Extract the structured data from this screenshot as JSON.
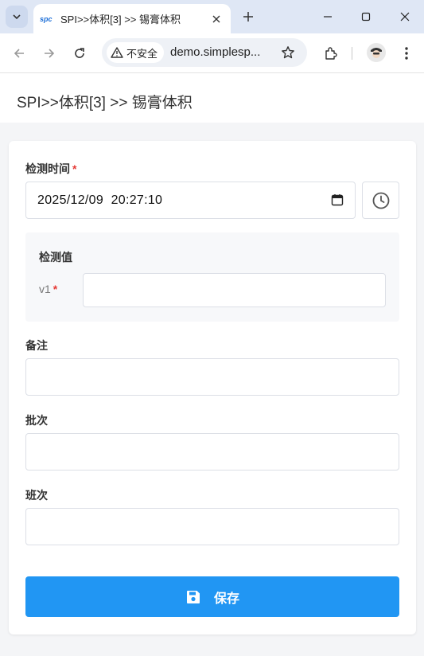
{
  "browser": {
    "tab": {
      "favicon_text": "spc",
      "title": "SPI>>体积[3] >> 锡膏体积"
    },
    "security_label": "不安全",
    "url": "demo.simplesp...",
    "icons": [
      "tab-search-icon",
      "close-icon",
      "plus-icon",
      "minimize-icon",
      "maximize-icon",
      "window-close-icon",
      "back-arrow-icon",
      "forward-arrow-icon",
      "reload-icon",
      "warning-icon",
      "star-icon",
      "extensions-icon",
      "more-icon"
    ]
  },
  "page": {
    "title": "SPI>>体积[3] >> 锡膏体积"
  },
  "form": {
    "time_label": "检测时间",
    "required_mark": "*",
    "time_value": "2025/12/09  20:27:10",
    "measure_title": "检测值",
    "v1_label": "v1",
    "v1_value": "",
    "remark_label": "备注",
    "remark_value": "",
    "batch_label": "批次",
    "batch_value": "",
    "shift_label": "班次",
    "shift_value": "",
    "save_label": "保存"
  },
  "colors": {
    "primary": "#2196f3",
    "required": "#e53935",
    "tabstrip": "#dfe7f5"
  }
}
